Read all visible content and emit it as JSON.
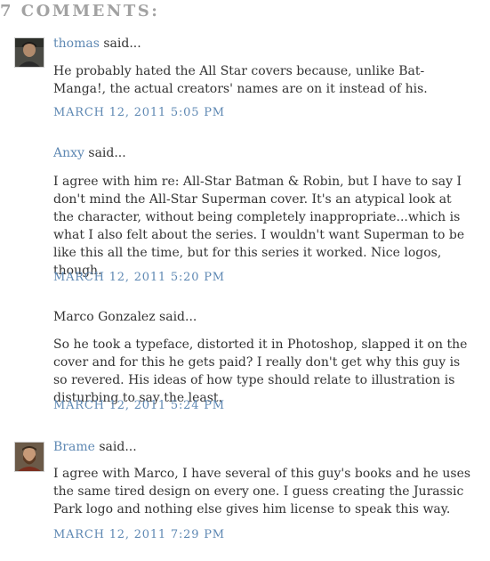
{
  "comments_heading": "7 COMMENTS:",
  "comments": [
    {
      "author": "thomas",
      "said": "said...",
      "has_link": true,
      "avatar": "dark-haired-man-photo",
      "body": "He probably hated the All Star covers because, unlike Bat-Manga!, the actual creators' names are on it instead of his.",
      "timestamp": "MARCH 12, 2011 5:05 PM"
    },
    {
      "author": "Anxy",
      "said": "said...",
      "has_link": true,
      "avatar": "",
      "body": "I agree with him re: All-Star Batman & Robin, but I have to say I don't mind the All-Star Superman cover. It's an atypical look at the character, without being completely inappropriate...which is what I also felt about the series. I wouldn't want Superman to be like this all the time, but for this series it worked. Nice logos, though.",
      "timestamp": "MARCH 12, 2011 5:20 PM"
    },
    {
      "author": "Marco Gonzalez",
      "said": "said...",
      "has_link": false,
      "avatar": "",
      "body": "So he took a typeface, distorted it in Photoshop, slapped it on the cover and for this he gets paid? I really don't get why this guy is so revered. His ideas of how type should relate to illustration is disturbing to say the least.",
      "timestamp": "MARCH 12, 2011 5:24 PM"
    },
    {
      "author": "Brame",
      "said": "said...",
      "has_link": true,
      "avatar": "bearded-man-photo",
      "body": "I agree with Marco, I have several of this guy's books and he uses the same tired design on every one. I guess creating the Jurassic Park logo and nothing else gives him license to speak this way.",
      "timestamp": "MARCH 12, 2011 7:29 PM"
    }
  ],
  "colors": {
    "link": "#5e88b3",
    "heading": "#a2a2a2",
    "text": "#333333"
  }
}
